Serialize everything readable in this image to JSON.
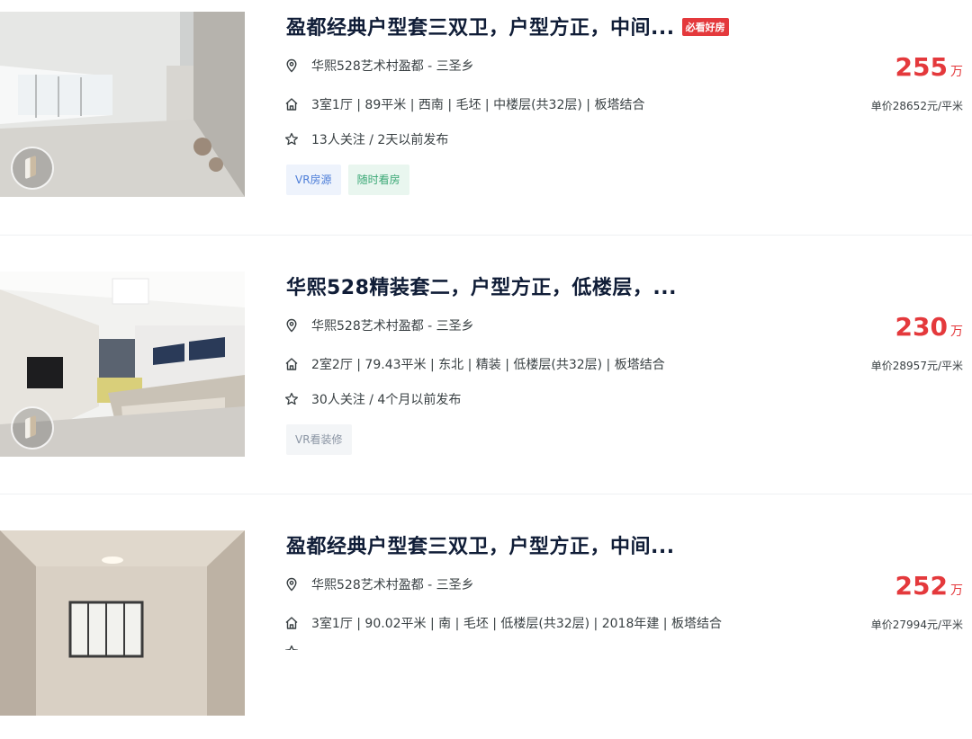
{
  "listings": [
    {
      "title": "盈都经典户型套三双卫，户型方正，中间...",
      "badge": "必看好房",
      "location": "华熙528艺术村盈都 - 三圣乡",
      "details": "3室1厅 | 89平米 | 西南 | 毛坯 | 中楼层(共32层) | 板塔结合",
      "follow": "13人关注 / 2天以前发布",
      "tags": [
        "VR房源",
        "随时看房"
      ],
      "price": "255",
      "price_unit": "万",
      "unit_price": "单价28652元/平米"
    },
    {
      "title": "华熙528精装套二，户型方正，低楼层，...",
      "location": "华熙528艺术村盈都 - 三圣乡",
      "details": "2室2厅 | 79.43平米 | 东北 | 精装 | 低楼层(共32层) | 板塔结合",
      "follow": "30人关注 / 4个月以前发布",
      "tags": [
        "VR看装修"
      ],
      "price": "230",
      "price_unit": "万",
      "unit_price": "单价28957元/平米"
    },
    {
      "title": "盈都经典户型套三双卫，户型方正，中间...",
      "location": "华熙528艺术村盈都 - 三圣乡",
      "details": "3室1厅 | 90.02平米 | 南 | 毛坯 | 低楼层(共32层) | 2018年建 | 板塔结合",
      "price": "252",
      "price_unit": "万",
      "unit_price": "单价27994元/平米"
    }
  ],
  "icons": {
    "location": "location-pin-icon",
    "house": "house-icon",
    "star": "star-icon",
    "vr": "vr-badge-icon"
  },
  "colors": {
    "price": "#e4393c",
    "title": "#101d37",
    "vr_tag": "#4c7dd8",
    "see_tag": "#3aa875"
  }
}
